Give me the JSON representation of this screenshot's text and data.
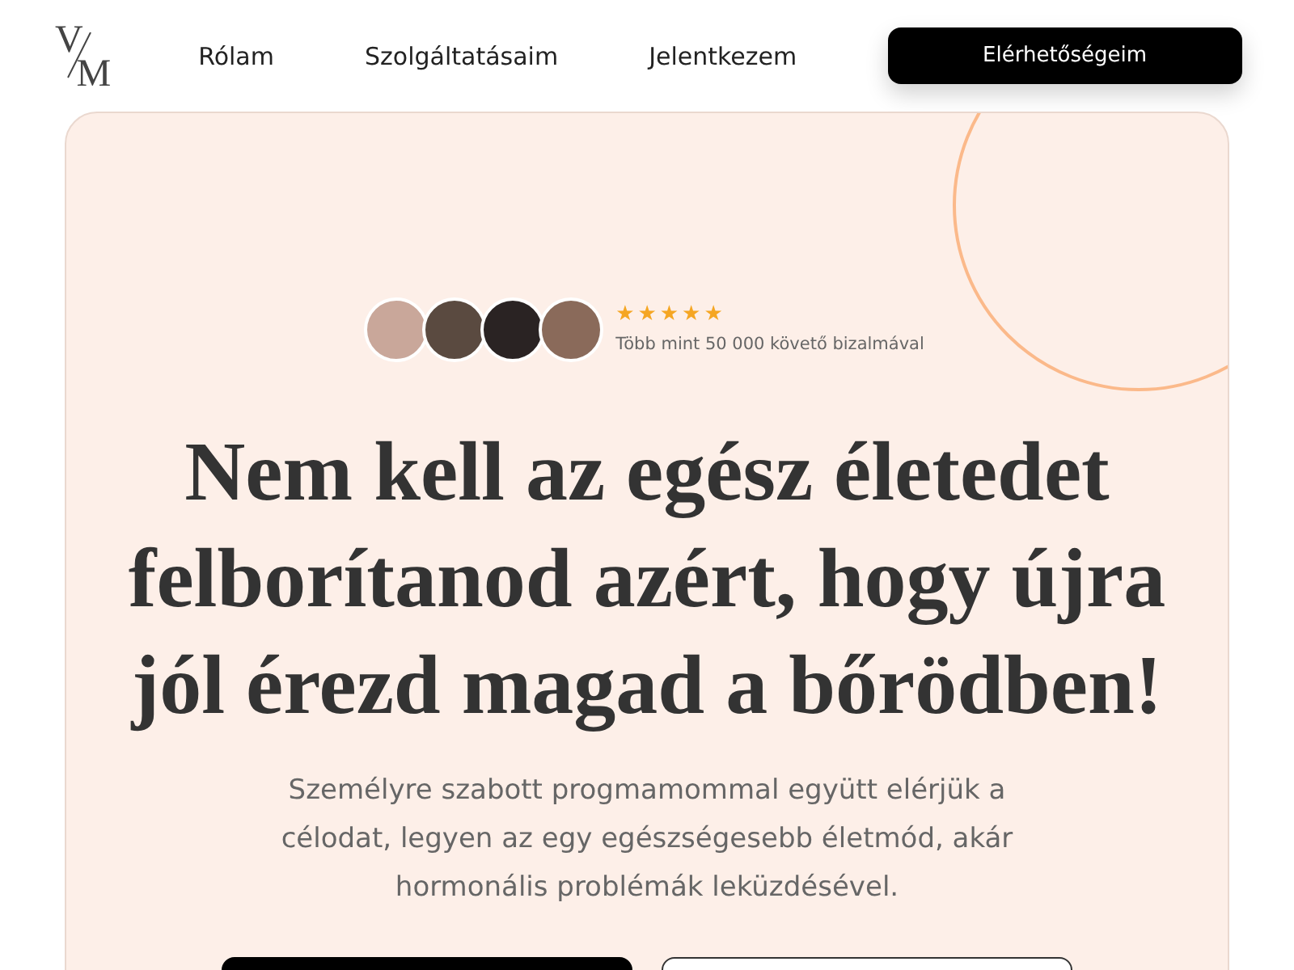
{
  "logo": {
    "top": "V",
    "bottom": "M"
  },
  "nav": [
    "Rólam",
    "Szolgáltatásaim",
    "Jelentkezem"
  ],
  "cta": "Elérhetőségeim",
  "hero": {
    "stars": 5,
    "trust": "Több mint 50 000 követő bizalmával",
    "title": "Nem kell az egész életedet felborítanod azért, hogy újra jól érezd magad a bőrödben!",
    "subtitle": "Személyre szabott progmamommal együtt elérjük a célodat, legyen az egy egészségesebb életmód, akár hormonális problémák leküzdésével.",
    "buttons": [
      {
        "kind": "solid"
      },
      {
        "kind": "outline"
      }
    ]
  }
}
